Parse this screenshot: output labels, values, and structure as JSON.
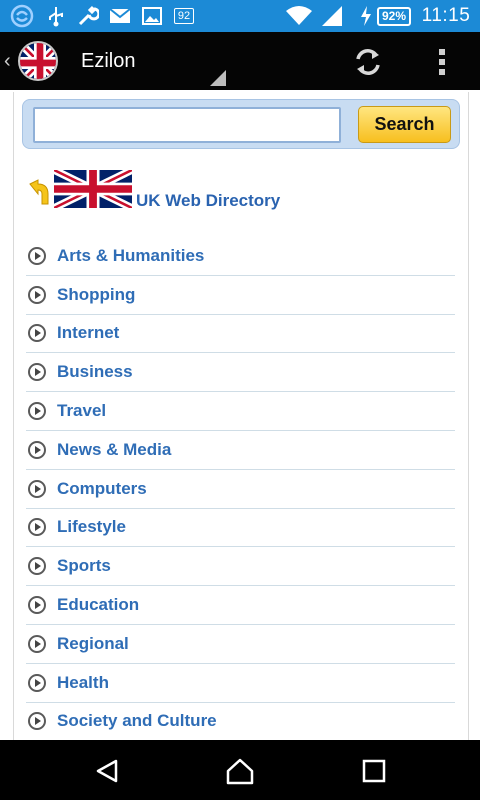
{
  "status_bar": {
    "time": "11:15",
    "battery": "92%",
    "notif_badge": "92",
    "icons": [
      "sync-icon",
      "usb-icon",
      "wrench-icon",
      "mail-icon",
      "image-icon",
      "badge-icon",
      "wifi-icon",
      "signal-icon",
      "charging-icon",
      "battery-icon"
    ]
  },
  "action_bar": {
    "title": "Ezilon"
  },
  "search": {
    "placeholder": "",
    "value": "",
    "button_label": "Search"
  },
  "directory": {
    "title": "UK Web Directory"
  },
  "categories": [
    "Arts & Humanities",
    "Shopping",
    "Internet",
    "Business",
    "Travel",
    "News & Media",
    "Computers",
    "Lifestyle",
    "Sports",
    "Education",
    "Regional",
    "Health",
    "Society and Culture"
  ],
  "colors": {
    "status_bar": "#1c8ad6",
    "action_bar": "#050505",
    "link": "#2f6db6",
    "search_button": "#f7bf1f"
  }
}
